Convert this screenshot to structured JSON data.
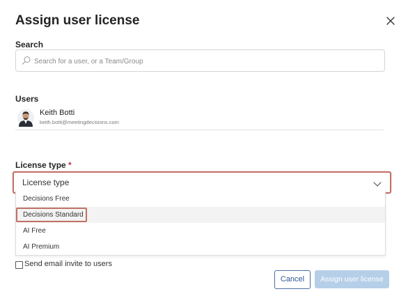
{
  "dialog": {
    "title": "Assign user license"
  },
  "search": {
    "label": "Search",
    "placeholder": "Search for a user, or a Team/Group"
  },
  "users": {
    "label": "Users",
    "items": [
      {
        "name": "Keith Botti",
        "email": "keith.botti@meetingdecisions.com"
      }
    ]
  },
  "license": {
    "label": "License type",
    "required_mark": "*",
    "selected": "License type",
    "options": [
      "Decisions Free",
      "Decisions Standard",
      "AI Free",
      "AI Premium"
    ]
  },
  "invite": {
    "label": "Send email invite to users",
    "checked": false
  },
  "actions": {
    "cancel_label": "Cancel",
    "assign_label": "Assign user license"
  },
  "colors": {
    "primary": "#2e5597",
    "disabled_button": "#b6cfe9",
    "highlight_border": "#c17167",
    "required": "#c4314b"
  },
  "icons": [
    "close-icon",
    "search-icon",
    "chevron-down-icon",
    "avatar"
  ]
}
